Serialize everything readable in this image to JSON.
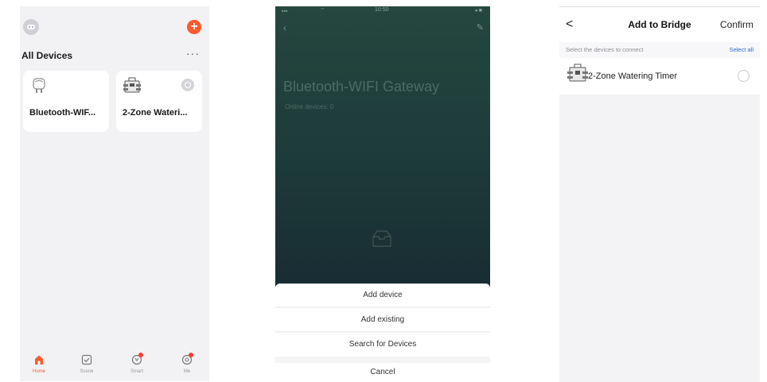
{
  "screen_home": {
    "section_title": "All Devices",
    "more_label": "···",
    "add_symbol": "+",
    "devices": [
      {
        "name": "Bluetooth-WIF...",
        "icon": "gateway-icon"
      },
      {
        "name": "2-Zone Wateri...",
        "icon": "watering-timer-icon"
      }
    ],
    "tabs": [
      {
        "label": "Home",
        "icon": "home-icon",
        "active": true
      },
      {
        "label": "Scene",
        "icon": "scene-icon",
        "active": false
      },
      {
        "label": "Smart",
        "icon": "smart-icon",
        "active": false
      },
      {
        "label": "Me",
        "icon": "me-icon",
        "active": false
      }
    ],
    "accent_color": "#ff5a2c"
  },
  "screen_gateway": {
    "status_time": "10:50",
    "title": "Bluetooth-WIFI Gateway",
    "online_devices": "Online devices: 0",
    "sheet_options": [
      "Add device",
      "Add existing",
      "Search for Devices"
    ],
    "cancel_label": "Cancel"
  },
  "screen_bridge": {
    "back_symbol": "<",
    "title": "Add to Bridge",
    "confirm_label": "Confirm",
    "subtitle": "Select the devices to connect",
    "select_all_label": "Select all",
    "device_name": "2-Zone Watering Timer",
    "link_color": "#2b68d8"
  }
}
